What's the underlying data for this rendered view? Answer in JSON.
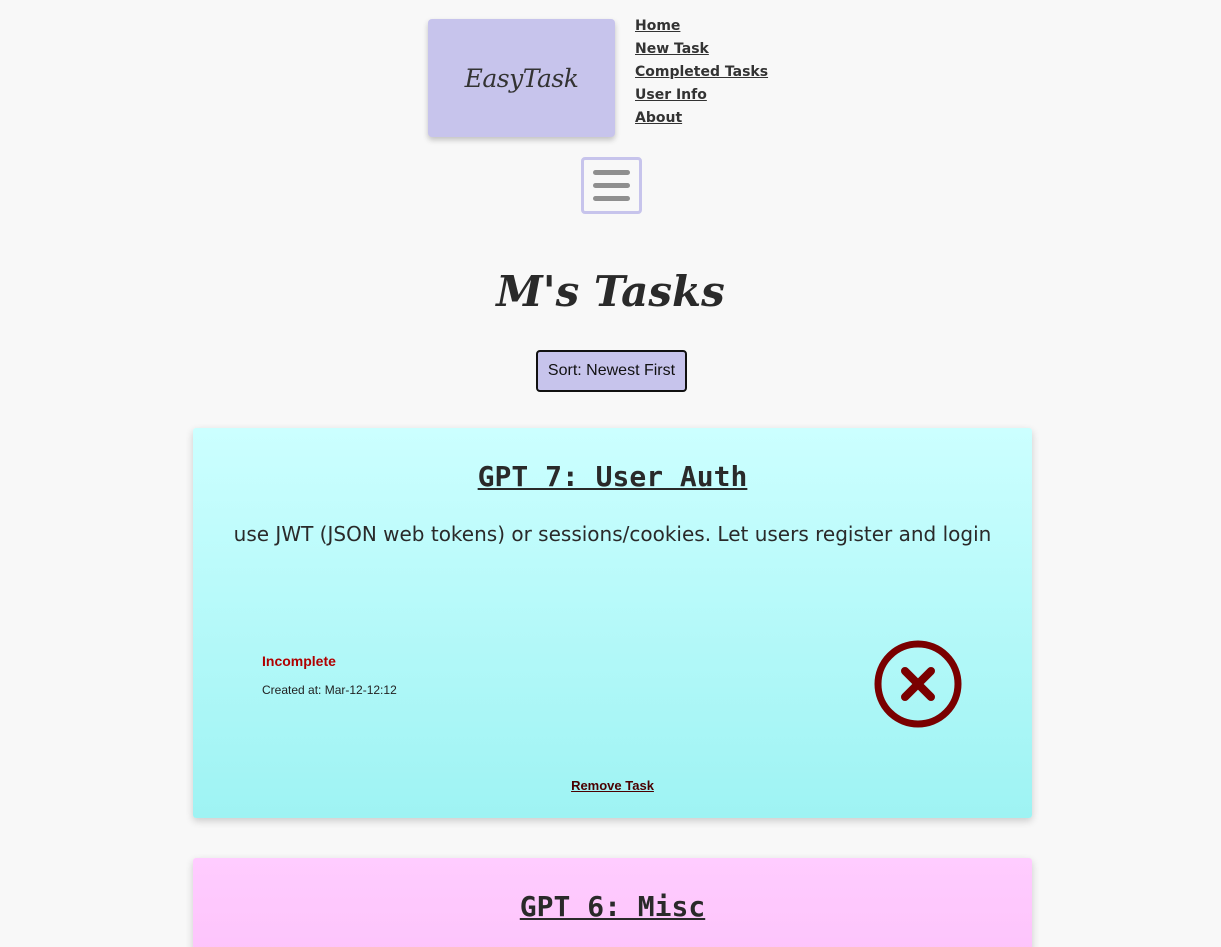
{
  "header": {
    "logo_text": "EasyTask",
    "nav": [
      "Home",
      "New Task",
      "Completed Tasks",
      "User Info",
      "About"
    ]
  },
  "page": {
    "title": "M's Tasks",
    "sort_label": "Sort: Newest First"
  },
  "tasks": [
    {
      "title": "GPT 7: User Auth",
      "description": "use JWT (JSON web tokens) or sessions/cookies. Let users register and login",
      "status": "Incomplete",
      "created": "Created at: Mar-12-12:12",
      "remove_label": "Remove Task",
      "status_icon": "x-circle-icon"
    },
    {
      "title": "GPT 6: Misc"
    }
  ],
  "colors": {
    "accent": "#c7c4ec",
    "card1_top": "#ccffff",
    "card1_bottom": "#9ef3f3",
    "card2": "#ffccff",
    "incomplete": "#b00000",
    "icon": "#7a0000"
  }
}
